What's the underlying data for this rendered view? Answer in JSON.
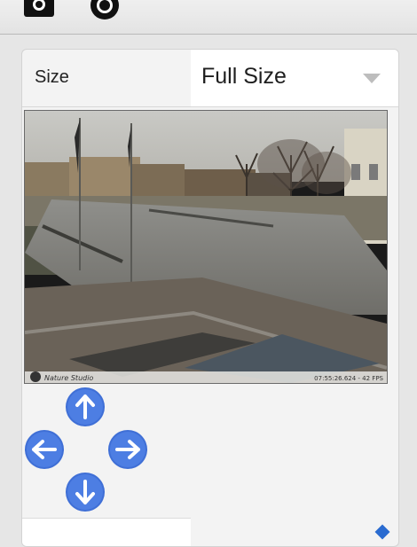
{
  "toolbar": {
    "snapshot_icon": "camera-icon",
    "record_icon": "record-icon"
  },
  "size": {
    "label": "Size",
    "selected": "Full Size"
  },
  "camera": {
    "overlay_left": "Nature Studio",
    "overlay_right": "07:55:26.624 - 42 FPS"
  },
  "ptz": {
    "up": "arrow-up-icon",
    "left": "arrow-left-icon",
    "right": "arrow-right-icon",
    "down": "arrow-down-icon"
  },
  "colors": {
    "ptz_blue": "#3f6fd6",
    "accent": "#2a6bd0"
  }
}
